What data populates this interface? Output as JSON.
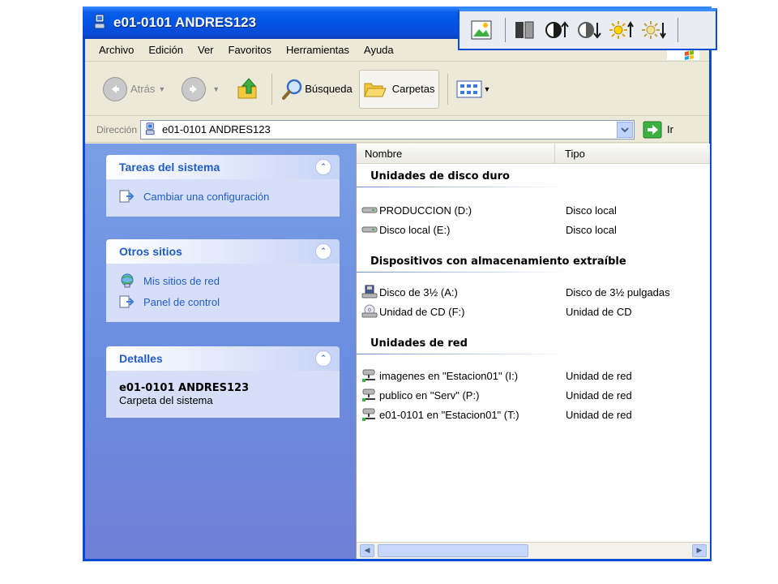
{
  "window": {
    "title": "e01-0101 ANDRES123"
  },
  "menu": [
    "Archivo",
    "Edición",
    "Ver",
    "Favoritos",
    "Herramientas",
    "Ayuda"
  ],
  "toolbar": {
    "back_label": "Atrás",
    "search_label": "Búsqueda",
    "folders_label": "Carpetas"
  },
  "address": {
    "label": "Dirección",
    "value": "e01-0101 ANDRES123",
    "go_label": "Ir"
  },
  "tasks": {
    "system": {
      "title": "Tareas del sistema",
      "links": [
        "Cambiar una configuración"
      ]
    },
    "other": {
      "title": "Otros sitios",
      "links": [
        "Mis sitios de red",
        "Panel de control"
      ]
    },
    "details": {
      "title": "Detalles",
      "name": "e01-0101 ANDRES123",
      "type": "Carpeta del sistema"
    }
  },
  "columns": {
    "name": "Nombre",
    "type": "Tipo"
  },
  "groups": [
    {
      "title": "Unidades de disco duro",
      "items": [
        {
          "name": "PRODUCCION (D:)",
          "type": "Disco local",
          "icon": "hard-drive-icon"
        },
        {
          "name": "Disco local (E:)",
          "type": "Disco local",
          "icon": "hard-drive-icon"
        }
      ]
    },
    {
      "title": "Dispositivos con almacenamiento extraíble",
      "items": [
        {
          "name": "Disco de 3½ (A:)",
          "type": "Disco de 3½ pulgadas",
          "icon": "floppy-icon"
        },
        {
          "name": "Unidad de CD (F:)",
          "type": "Unidad de CD",
          "icon": "cd-drive-icon"
        }
      ]
    },
    {
      "title": "Unidades de red",
      "items": [
        {
          "name": "imagenes en \"Estacion01\" (I:)",
          "type": "Unidad de red",
          "icon": "network-drive-icon"
        },
        {
          "name": "publico en \"Serv\" (P:)",
          "type": "Unidad de red",
          "icon": "network-drive-icon"
        },
        {
          "name": "e01-0101 en \"Estacion01\" (T:)",
          "type": "Unidad de red",
          "icon": "network-drive-icon"
        }
      ]
    }
  ],
  "colors": {
    "titlebar": "#0054e3",
    "taskpane": "#6b8ee0",
    "link": "#215dc6"
  }
}
